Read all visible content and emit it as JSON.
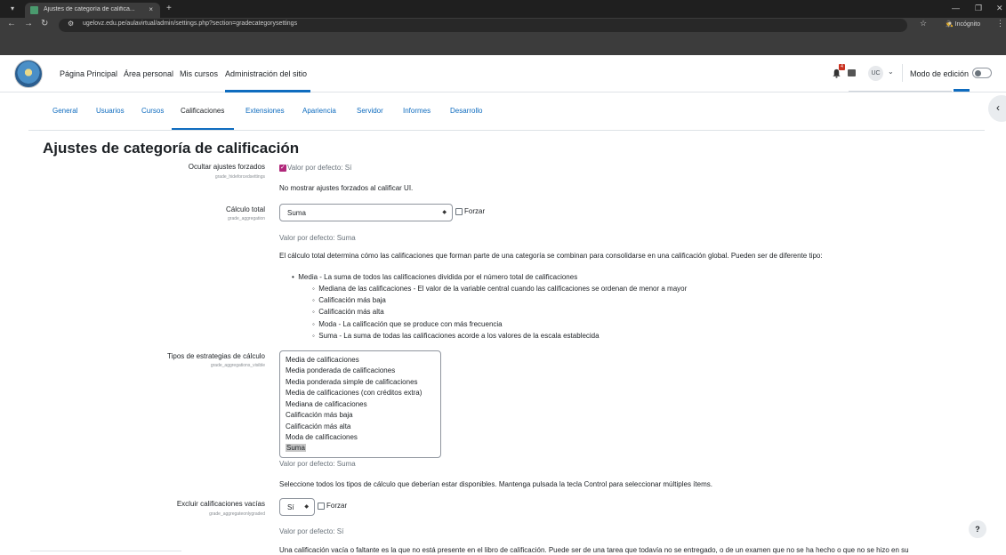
{
  "browser": {
    "tab_title": "Ajustes de categoría de califica...",
    "tab_close": "×",
    "new_tab": "+",
    "url": "ugelovz.edu.pe/aulavirtual/admin/settings.php?section=gradecategorysettings",
    "incognito_label": "Incógnito"
  },
  "navbar": {
    "links": [
      "Página Principal",
      "Área personal",
      "Mis cursos",
      "Administración del sitio"
    ],
    "notification_count": "4",
    "user_initials": "UC",
    "edit_mode_label": "Modo de edición"
  },
  "secondary_nav": {
    "links": [
      "General",
      "Usuarios",
      "Cursos",
      "Calificaciones",
      "Extensiones",
      "Apariencia",
      "Servidor",
      "Informes",
      "Desarrollo"
    ],
    "active": "Calificaciones"
  },
  "page": {
    "title": "Ajustes de categoría de calificación",
    "settings": {
      "hide_forced": {
        "label": "Ocultar ajustes forzados",
        "sublabel": "grade_hideforcedsettings",
        "default": "Valor por defecto: Sí",
        "description": "No mostrar ajustes forzados al calificar UI."
      },
      "aggregation": {
        "label": "Cálculo total",
        "sublabel": "grade_aggregation",
        "value": "Suma",
        "force_label": "Forzar",
        "default": "Valor por defecto: Suma",
        "description": "El cálculo total determina cómo las calificaciones que forman parte de una categoría se combinan para consolidarse en una calificación global. Pueden ser de diferente tipo:",
        "bullet_main": "Media - La suma de todos las calificaciones dividida por el número total de calificaciones",
        "bullets": [
          "Mediana de las calificaciones - El valor de la variable central cuando las calificaciones se ordenan de menor a mayor",
          "Calificación más baja",
          "Calificación más alta",
          "Moda - La calificación que se produce con más frecuencia",
          "Suma - La suma de todas las calificaciones acorde a los valores de la escala establecida"
        ]
      },
      "aggregations_visible": {
        "label": "Tipos de estrategias de cálculo",
        "sublabel": "grade_aggregations_visible",
        "options": [
          "Media de calificaciones",
          "Media ponderada de calificaciones",
          "Media ponderada simple de calificaciones",
          "Media de calificaciones (con créditos extra)",
          "Mediana de calificaciones",
          "Calificación más baja",
          "Calificación más alta",
          "Moda de calificaciones",
          "Suma"
        ],
        "selected": "Suma",
        "default": "Valor por defecto: Suma",
        "description": "Seleccione todos los tipos de cálculo que deberían estar disponibles. Mantenga pulsada la tecla Control para seleccionar múltiples ítems."
      },
      "only_graded": {
        "label": "Excluir calificaciones vacías",
        "sublabel": "grade_aggregateonlygraded",
        "value": "Sí",
        "force_label": "Forzar",
        "default": "Valor por defecto: Sí",
        "description": "Una calificación vacía o faltante es la que no está presente en el libro de calificación. Puede ser de una tarea que todavía no se entregado, o de un examen que no se ha hecho o que no se hizo en su"
      }
    }
  },
  "help_label": "?"
}
